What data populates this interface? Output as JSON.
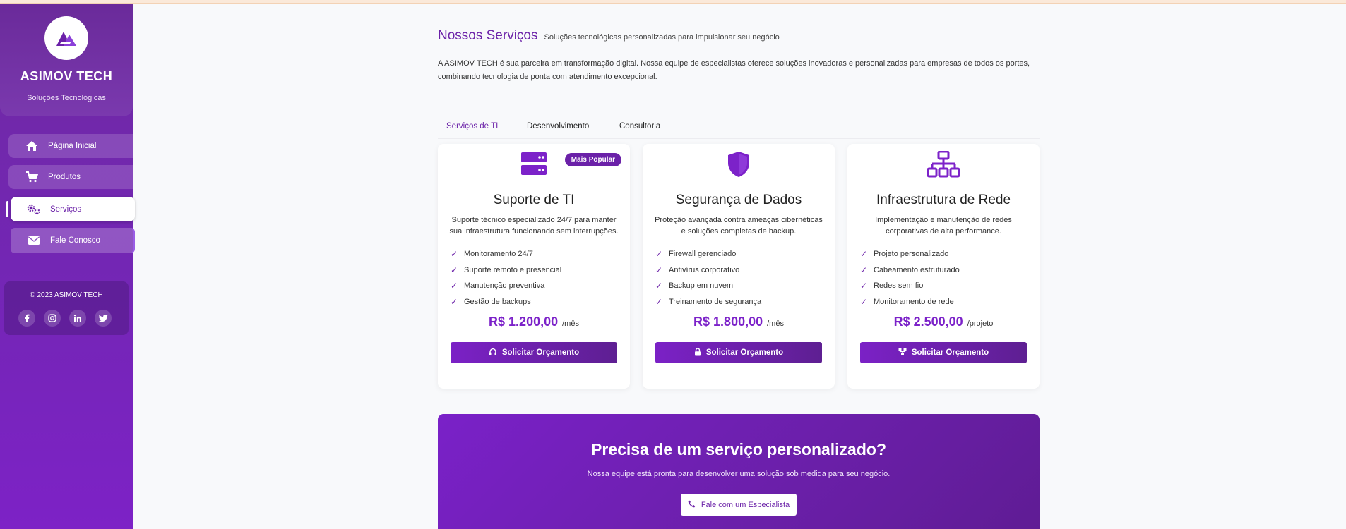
{
  "colors": {
    "accent": "#6b21a8",
    "accent_light": "#7c22c9",
    "sidebar": "#7326b4",
    "background": "#f8f9fb"
  },
  "sidebar": {
    "brand_title": "ASIMOV TECH",
    "brand_subtitle": "Soluções Tecnológicas",
    "logo_icon": "asimov-logo-icon",
    "items": [
      {
        "label": "Página Inicial",
        "icon": "home-icon",
        "active": false
      },
      {
        "label": "Produtos",
        "icon": "cart-icon",
        "active": false
      },
      {
        "label": "Serviços",
        "icon": "gears-icon",
        "active": true
      },
      {
        "label": "Fale Conosco",
        "icon": "envelope-icon",
        "active": false
      }
    ],
    "copyright": "© 2023 ASIMOV TECH",
    "socials": [
      "facebook-icon",
      "instagram-icon",
      "linkedin-icon",
      "twitter-icon"
    ]
  },
  "main": {
    "title": "Nossos Serviços",
    "subtitle": "Soluções tecnológicas personalizadas para impulsionar seu negócio",
    "intro": "A ASIMOV TECH é sua parceira em transformação digital. Nossa equipe de especialistas oferece soluções inovadoras e personalizadas para empresas de todos os portes, combinando tecnologia de ponta com atendimento excepcional.",
    "tabs": [
      {
        "label": "Serviços de TI",
        "active": true
      },
      {
        "label": "Desenvolvimento",
        "active": false
      },
      {
        "label": "Consultoria",
        "active": false
      }
    ],
    "cards": [
      {
        "icon": "server-icon",
        "badge": "Mais Popular",
        "title": "Suporte de TI",
        "description": "Suporte técnico especializado 24/7 para manter sua infraestrutura funcionando sem interrupções.",
        "features": [
          "Monitoramento 24/7",
          "Suporte remoto e presencial",
          "Manutenção preventiva",
          "Gestão de backups"
        ],
        "price": "R$ 1.200,00",
        "unit": "/mês",
        "cta": "Solicitar Orçamento",
        "cta_icon": "headset-icon"
      },
      {
        "icon": "shield-icon",
        "badge": "",
        "title": "Segurança de Dados",
        "description": "Proteção avançada contra ameaças cibernéticas e soluções completas de backup.",
        "features": [
          "Firewall gerenciado",
          "Antivírus corporativo",
          "Backup em nuvem",
          "Treinamento de segurança"
        ],
        "price": "R$ 1.800,00",
        "unit": "/mês",
        "cta": "Solicitar Orçamento",
        "cta_icon": "lock-icon"
      },
      {
        "icon": "network-icon",
        "badge": "",
        "title": "Infraestrutura de Rede",
        "description": "Implementação e manutenção de redes corporativas de alta performance.",
        "features": [
          "Projeto personalizado",
          "Cabeamento estruturado",
          "Redes sem fio",
          "Monitoramento de rede"
        ],
        "price": "R$ 2.500,00",
        "unit": "/projeto",
        "cta": "Solicitar Orçamento",
        "cta_icon": "network-icon"
      }
    ],
    "banner": {
      "title": "Precisa de um serviço personalizado?",
      "subtitle": "Nossa equipe está pronta para desenvolver uma solução sob medida para seu negócio.",
      "button": "Fale com um Especialista",
      "button_icon": "phone-icon"
    }
  }
}
